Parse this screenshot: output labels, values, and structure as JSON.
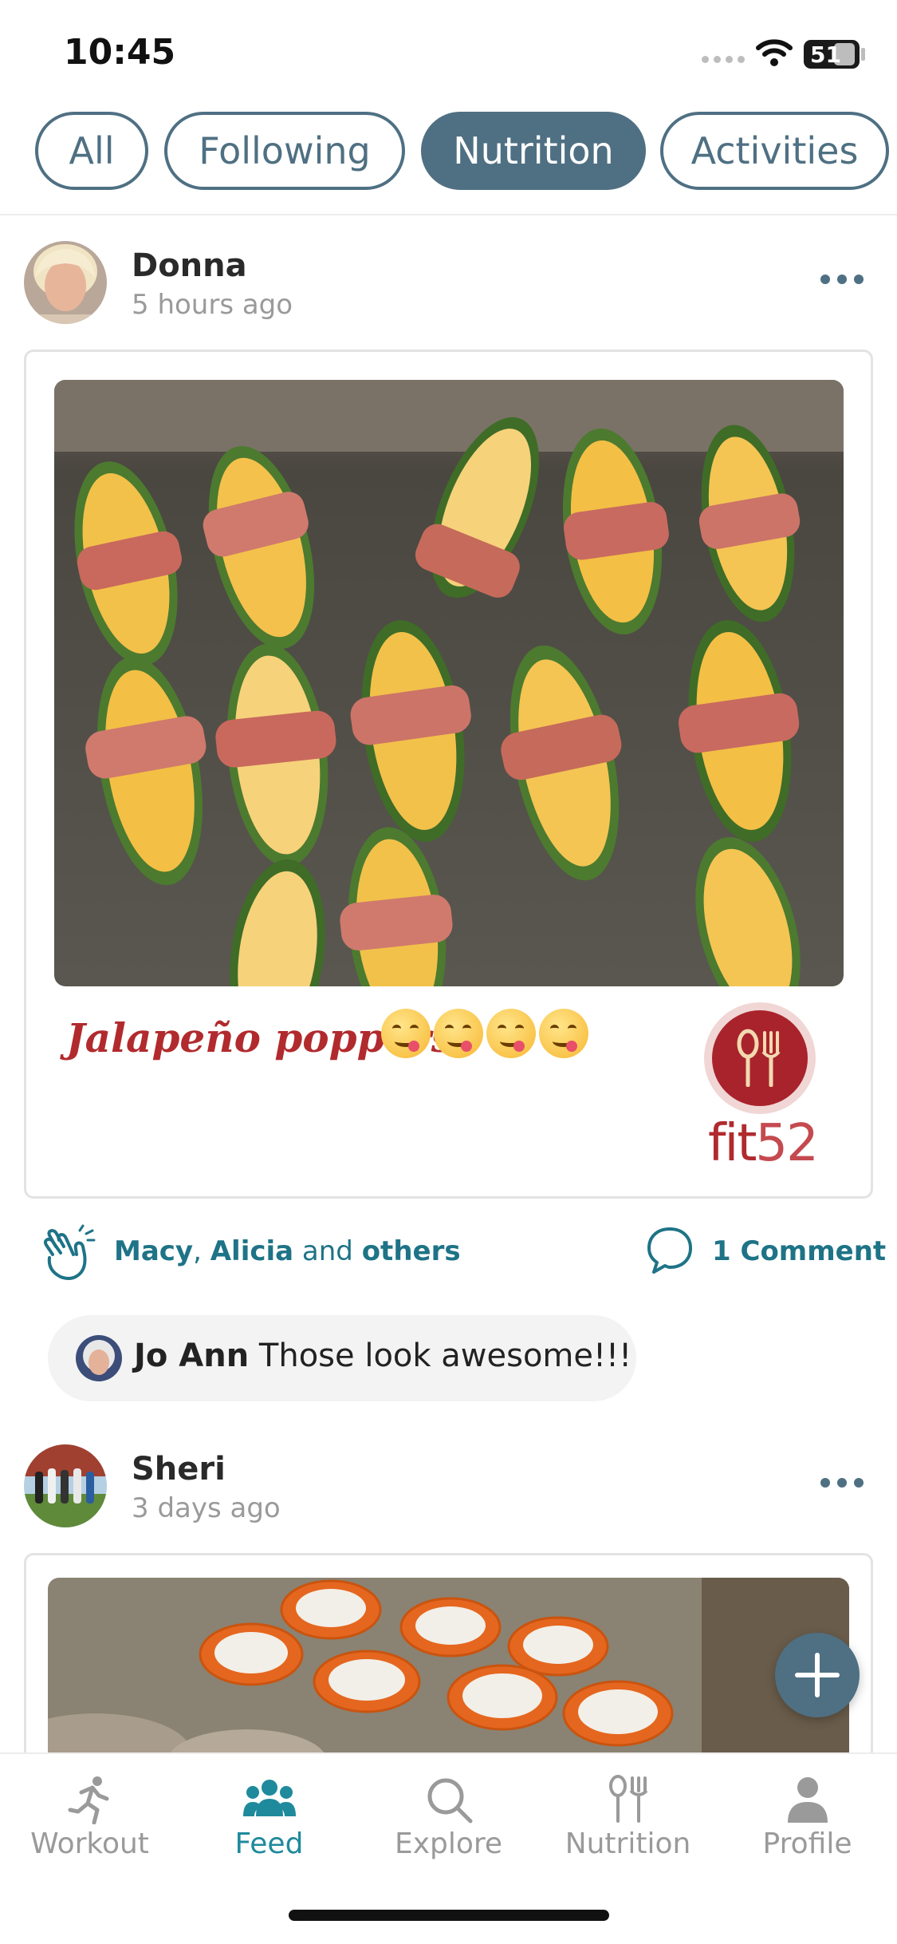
{
  "status_bar": {
    "time": "10:45",
    "battery": "51"
  },
  "filters": [
    {
      "label": "All",
      "active": false
    },
    {
      "label": "Following",
      "active": false
    },
    {
      "label": "Nutrition",
      "active": true
    },
    {
      "label": "Activities",
      "active": false
    }
  ],
  "posts": [
    {
      "author": "Donna",
      "time_ago": "5 hours ago",
      "photo_icon": "jalapeno-poppers-photo",
      "caption": "Jalapeño poppers",
      "emoji_count": 4,
      "brand": {
        "logo_icon": "spoon-fork-icon",
        "text_a": "fit",
        "text_b": "52"
      },
      "reactions": {
        "name1": "Macy",
        "sep": ", ",
        "name2": "Alicia",
        "and": " and ",
        "others": "others"
      },
      "comment_count_label": "1 Comment",
      "top_comment": {
        "author": "Jo Ann",
        "text": "Those look awesome!!!"
      }
    },
    {
      "author": "Sheri",
      "time_ago": "3 days ago",
      "photo_icon": "jars-on-counter-photo"
    }
  ],
  "tabbar": [
    {
      "label": "Workout",
      "icon": "running-person-icon",
      "active": false
    },
    {
      "label": "Feed",
      "icon": "people-group-icon",
      "active": true
    },
    {
      "label": "Explore",
      "icon": "search-icon",
      "active": false
    },
    {
      "label": "Nutrition",
      "icon": "spoon-fork-icon",
      "active": false
    },
    {
      "label": "Profile",
      "icon": "person-icon",
      "active": false
    }
  ],
  "colors": {
    "accent": "#4f6f82",
    "link": "#1e7386",
    "brand_red": "#b02a2e",
    "active_tab": "#1e8a9c"
  }
}
